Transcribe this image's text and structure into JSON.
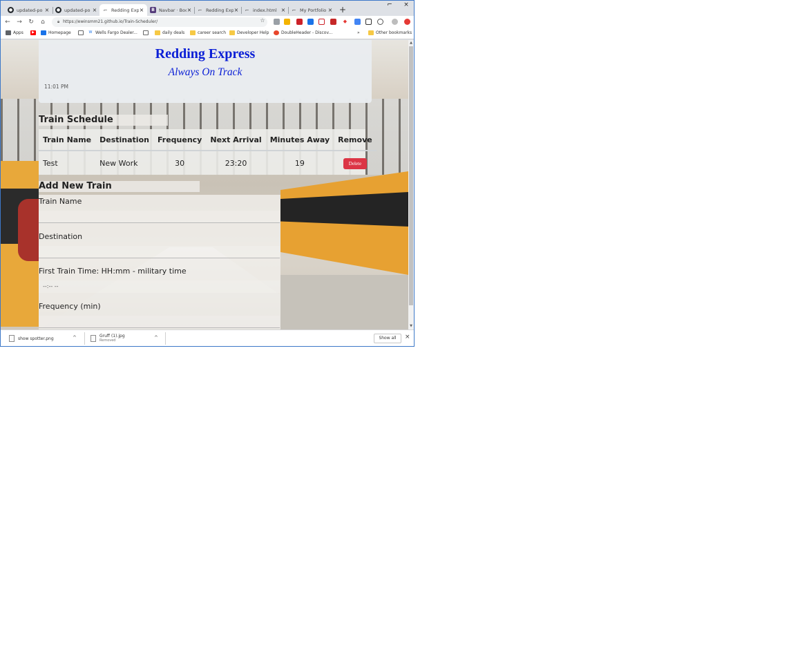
{
  "browser": {
    "tabs": [
      {
        "label": "updated-po",
        "favicon": "github-icon",
        "active": false
      },
      {
        "label": "updated-po",
        "favicon": "github-icon",
        "active": false
      },
      {
        "label": "Redding Exp",
        "favicon": "page-icon",
        "active": true
      },
      {
        "label": "Navbar · Boo",
        "favicon": "bootstrap-icon",
        "active": false
      },
      {
        "label": "Redding Exp",
        "favicon": "page-icon",
        "active": false
      },
      {
        "label": "index.html",
        "favicon": "page-icon",
        "active": false
      },
      {
        "label": "My Portfolio",
        "favicon": "page-icon",
        "active": false
      }
    ],
    "new_tab_label": "+",
    "url": "https://ewinsmm21.github.io/Train-Scheduler/",
    "bookmarks": [
      {
        "label": "Apps",
        "icon": "apps-grid-icon"
      },
      {
        "label": "",
        "icon": "youtube-icon"
      },
      {
        "label": "Homepage",
        "icon": "page-icon"
      },
      {
        "label": "",
        "icon": "page-icon"
      },
      {
        "label": "Wells Fargo Dealer...",
        "icon": "page-icon"
      },
      {
        "label": "",
        "icon": "page-icon"
      },
      {
        "label": "daily deals",
        "icon": "folder-icon"
      },
      {
        "label": "career search",
        "icon": "folder-icon"
      },
      {
        "label": "Developer Help",
        "icon": "folder-icon"
      },
      {
        "label": "DoubleHeader - Discov...",
        "icon": "page-icon"
      }
    ],
    "bookmarks_overflow": "»",
    "other_bookmarks": "Other bookmarks"
  },
  "page": {
    "title": "Redding Express",
    "tagline": "Always On Track",
    "clock": "11:01 PM",
    "schedule": {
      "heading": "Train Schedule",
      "columns": [
        "Train Name",
        "Destination",
        "Frequency",
        "Next Arrival",
        "Minutes Away",
        "Remove"
      ],
      "rows": [
        {
          "train_name": "Test",
          "destination": "New Work",
          "frequency": "30",
          "next_arrival": "23:20",
          "minutes_away": "19",
          "remove_label": "Delete"
        }
      ]
    },
    "form": {
      "heading": "Add New Train",
      "train_name_label": "Train Name",
      "train_name_value": "",
      "destination_label": "Destination",
      "destination_value": "",
      "first_time_label": "First Train Time: HH:mm - military time",
      "first_time_placeholder": "--:-- --",
      "frequency_label": "Frequency (min)",
      "frequency_value": ""
    }
  },
  "downloads": {
    "items": [
      {
        "name": "show spotter.png",
        "sub": ""
      },
      {
        "name": "Gruff (1).jpg",
        "sub": "Removed"
      }
    ],
    "show_all_label": "Show all"
  },
  "colors": {
    "title_blue": "#0c20d6",
    "delete_red": "#dc3545",
    "window_border": "#3c78c8"
  }
}
